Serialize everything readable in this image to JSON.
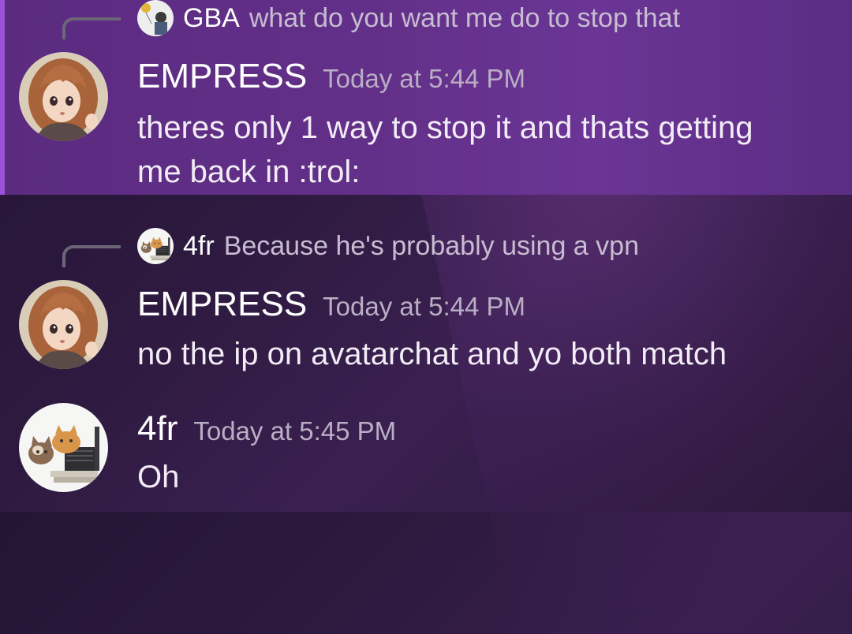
{
  "messages": [
    {
      "reply": {
        "author": "GBA",
        "text": "what do you want me do to stop that",
        "avatar_icon": "boy-with-balloon-avatar-icon"
      },
      "author": "EMPRESS",
      "timestamp": "Today at 5:44 PM",
      "lines": [
        "theres only 1 way to stop it and thats getting",
        "me back in :trol:"
      ],
      "avatar_icon": "anime-girl-avatar-icon",
      "highlighted": true
    },
    {
      "reply": {
        "author": "4fr",
        "text": "Because he's probably using a vpn",
        "avatar_icon": "cats-with-laptop-avatar-icon"
      },
      "author": "EMPRESS",
      "timestamp": "Today at 5:44 PM",
      "lines": [
        "no the ip on avatarchat and yo both match"
      ],
      "avatar_icon": "anime-girl-avatar-icon",
      "highlighted": false
    },
    {
      "author": "4fr",
      "timestamp": "Today at 5:45 PM",
      "lines": [
        "Oh"
      ],
      "avatar_icon": "cats-with-laptop-avatar-icon",
      "highlighted": false
    }
  ],
  "colors": {
    "highlight_accent": "#9b52d6",
    "highlight_band": "#633089",
    "background": "#2e1a40",
    "timestamp": "#b9aec4",
    "reply_text": "#c7bcd1"
  }
}
